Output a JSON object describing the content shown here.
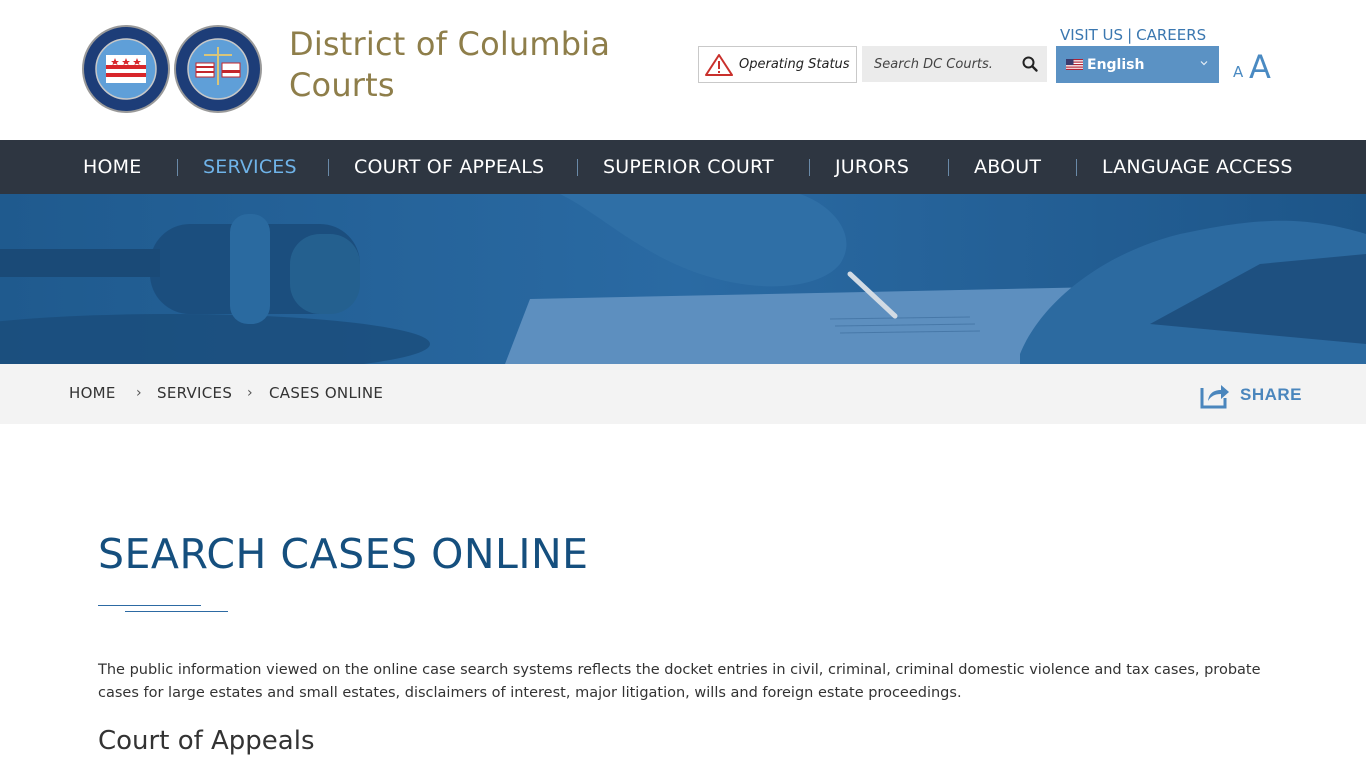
{
  "header": {
    "title_line1": "District of Columbia",
    "title_line2": "Courts",
    "seal1_name": "DISTRICT OF COLUMBIA COURT OF APPEALS",
    "seal2_name": "SUPERIOR COURT DISTRICT OF COLUMBIA",
    "top_links": [
      "VISIT US",
      "CAREERS"
    ],
    "top_links_sep": "|",
    "operating_status": "Operating Status",
    "search_placeholder": "Search DC Courts.",
    "language": "English",
    "font_small": "A",
    "font_large": "A",
    "colors": {
      "title": "#8e7e4a",
      "link": "#3a77b0",
      "lang_bg": "#5b92c4"
    }
  },
  "nav": {
    "items": [
      "HOME",
      "SERVICES",
      "COURT OF APPEALS",
      "SUPERIOR COURT",
      "JURORS",
      "ABOUT",
      "LANGUAGE ACCESS"
    ],
    "active": "SERVICES",
    "colors": {
      "bg": "#2e3641",
      "active": "#6fb3e8"
    }
  },
  "breadcrumb": {
    "items": [
      "HOME",
      "SERVICES",
      "CASES ONLINE"
    ],
    "separator": "›",
    "share": "SHARE"
  },
  "main": {
    "title": "SEARCH CASES ONLINE",
    "intro": "The public information viewed on the online case search systems reflects the docket entries in civil, criminal, criminal domestic violence and tax cases, probate cases for large estates and small estates, disclaimers of interest, major litigation, wills and foreign estate proceedings.",
    "section_heading": "Court of Appeals"
  }
}
